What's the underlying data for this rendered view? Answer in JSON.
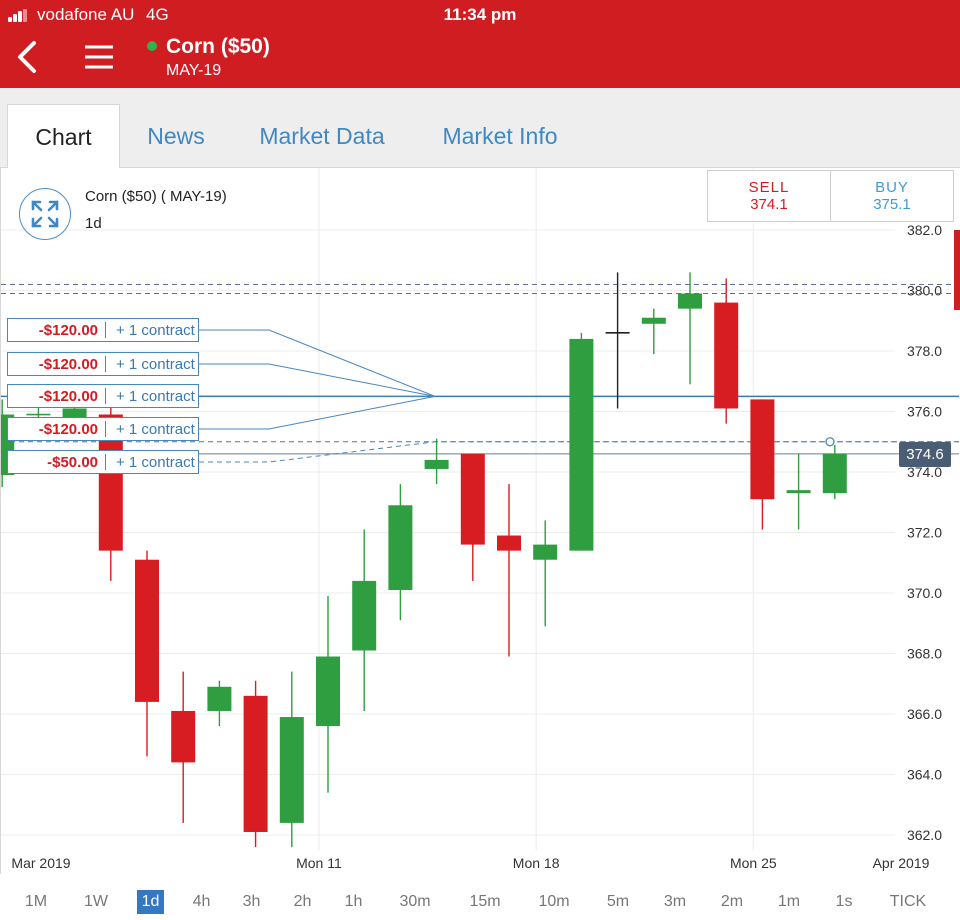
{
  "status_bar": {
    "carrier": "vodafone AU",
    "network": "4G",
    "time": "11:34 pm"
  },
  "header": {
    "title": "Corn ($50)",
    "subtitle": "MAY-19",
    "back_icon": "chevron-left-icon",
    "menu_icon": "hamburger-menu-icon",
    "live_indicator_color": "#2fb24c",
    "brand_color": "#d01d22"
  },
  "tabs": [
    {
      "label": "Chart",
      "active": true
    },
    {
      "label": "News",
      "active": false
    },
    {
      "label": "Market Data",
      "active": false
    },
    {
      "label": "Market Info",
      "active": false
    }
  ],
  "chart_header": {
    "title": "Corn ($50) ( MAY-19)",
    "interval": "1d",
    "expand_icon": "expand-arrows-icon"
  },
  "quote": {
    "sell_label": "SELL",
    "sell_price": "374.1",
    "buy_label": "BUY",
    "buy_price": "375.1"
  },
  "orders": [
    {
      "pl": "-$120.00",
      "qty": "+ 1 contract"
    },
    {
      "pl": "-$120.00",
      "qty": "+ 1 contract"
    },
    {
      "pl": "-$120.00",
      "qty": "+ 1 contract"
    },
    {
      "pl": "-$120.00",
      "qty": "+ 1 contract"
    },
    {
      "pl": "-$50.00",
      "qty": "+ 1 contract"
    }
  ],
  "current_price_label": "374.6",
  "periods": [
    {
      "label": "1M",
      "active": false
    },
    {
      "label": "1W",
      "active": false
    },
    {
      "label": "1d",
      "active": true
    },
    {
      "label": "4h",
      "active": false
    },
    {
      "label": "3h",
      "active": false
    },
    {
      "label": "2h",
      "active": false
    },
    {
      "label": "1h",
      "active": false
    },
    {
      "label": "30m",
      "active": false
    },
    {
      "label": "15m",
      "active": false
    },
    {
      "label": "10m",
      "active": false
    },
    {
      "label": "5m",
      "active": false
    },
    {
      "label": "3m",
      "active": false
    },
    {
      "label": "2m",
      "active": false
    },
    {
      "label": "1m",
      "active": false
    },
    {
      "label": "1s",
      "active": false
    },
    {
      "label": "TICK",
      "active": false
    }
  ],
  "chart_data": {
    "type": "candlestick",
    "title": "Corn ($50) ( MAY-19)",
    "interval": "1d",
    "ylim": [
      361.5,
      382.5
    ],
    "y_ticks": [
      "382.0",
      "380.0",
      "378.0",
      "376.0",
      "374.0",
      "372.0",
      "370.0",
      "368.0",
      "366.0",
      "364.0",
      "362.0"
    ],
    "x_labels": [
      {
        "label": "Mar 2019",
        "slot": -3.4
      },
      {
        "label": "Mon 11",
        "slot": 4.75
      },
      {
        "label": "Mon 18",
        "slot": 10.75
      },
      {
        "label": "Mon 25",
        "slot": 16.75
      },
      {
        "label": "Apr 2019",
        "slot": 22.75
      }
    ],
    "up_color": "#2e9e40",
    "down_color": "#d71d22",
    "candles": [
      {
        "slot": -4,
        "open": 373.9,
        "close": 375.9,
        "high": 376.4,
        "low": 373.5
      },
      {
        "slot": -3,
        "open": 375.9,
        "close": 375.9,
        "high": 376.6,
        "low": 375.6
      },
      {
        "slot": -2,
        "open": 375.7,
        "close": 376.1,
        "high": 376.6,
        "low": 375.5
      },
      {
        "slot": -1,
        "open": 375.9,
        "close": 371.4,
        "high": 376.4,
        "low": 370.4
      },
      {
        "slot": 0,
        "open": 371.1,
        "close": 366.4,
        "high": 371.4,
        "low": 364.6
      },
      {
        "slot": 1,
        "open": 366.1,
        "close": 364.4,
        "high": 367.4,
        "low": 362.4
      },
      {
        "slot": 2,
        "open": 366.1,
        "close": 366.9,
        "high": 367.1,
        "low": 365.6
      },
      {
        "slot": 3,
        "open": 366.6,
        "close": 362.1,
        "high": 367.1,
        "low": 361.6
      },
      {
        "slot": 4,
        "open": 362.4,
        "close": 365.9,
        "high": 367.4,
        "low": 361.6
      },
      {
        "slot": 5,
        "open": 365.6,
        "close": 367.9,
        "high": 369.9,
        "low": 363.4
      },
      {
        "slot": 6,
        "open": 368.1,
        "close": 370.4,
        "high": 372.1,
        "low": 366.1
      },
      {
        "slot": 7,
        "open": 370.1,
        "close": 372.9,
        "high": 373.6,
        "low": 369.1
      },
      {
        "slot": 8,
        "open": 374.1,
        "close": 374.4,
        "high": 375.1,
        "low": 373.6
      },
      {
        "slot": 9,
        "open": 374.6,
        "close": 371.6,
        "high": 374.6,
        "low": 370.4
      },
      {
        "slot": 10,
        "open": 371.9,
        "close": 371.4,
        "high": 373.6,
        "low": 367.9
      },
      {
        "slot": 11,
        "open": 371.1,
        "close": 371.6,
        "high": 372.4,
        "low": 368.9
      },
      {
        "slot": 12,
        "open": 371.4,
        "close": 378.4,
        "high": 378.6,
        "low": 371.4
      },
      {
        "slot": 13,
        "open": 378.6,
        "close": 378.6,
        "high": 380.6,
        "low": 376.1
      },
      {
        "slot": 14,
        "open": 378.9,
        "close": 379.1,
        "high": 379.4,
        "low": 377.9
      },
      {
        "slot": 15,
        "open": 379.4,
        "close": 379.9,
        "high": 380.6,
        "low": 376.9
      },
      {
        "slot": 16,
        "open": 379.6,
        "close": 376.1,
        "high": 380.4,
        "low": 375.6
      },
      {
        "slot": 17,
        "open": 376.4,
        "close": 373.1,
        "high": 376.4,
        "low": 372.1
      },
      {
        "slot": 18,
        "open": 373.3,
        "close": 373.4,
        "high": 374.6,
        "low": 372.1
      },
      {
        "slot": 19,
        "open": 373.3,
        "close": 374.6,
        "high": 374.9,
        "low": 373.1
      }
    ],
    "reference_lines": [
      {
        "price": 380.2,
        "style": "dashed"
      },
      {
        "price": 379.9,
        "style": "dashed"
      },
      {
        "price": 376.5,
        "style": "solid"
      },
      {
        "price": 374.6,
        "style": "solid"
      },
      {
        "price": 375.0,
        "style": "dashed"
      }
    ],
    "order_entries": [
      380.8,
      379.6,
      376.5,
      375.4,
      374.4
    ],
    "convergence_price": 376.5,
    "current_price": 374.6
  }
}
